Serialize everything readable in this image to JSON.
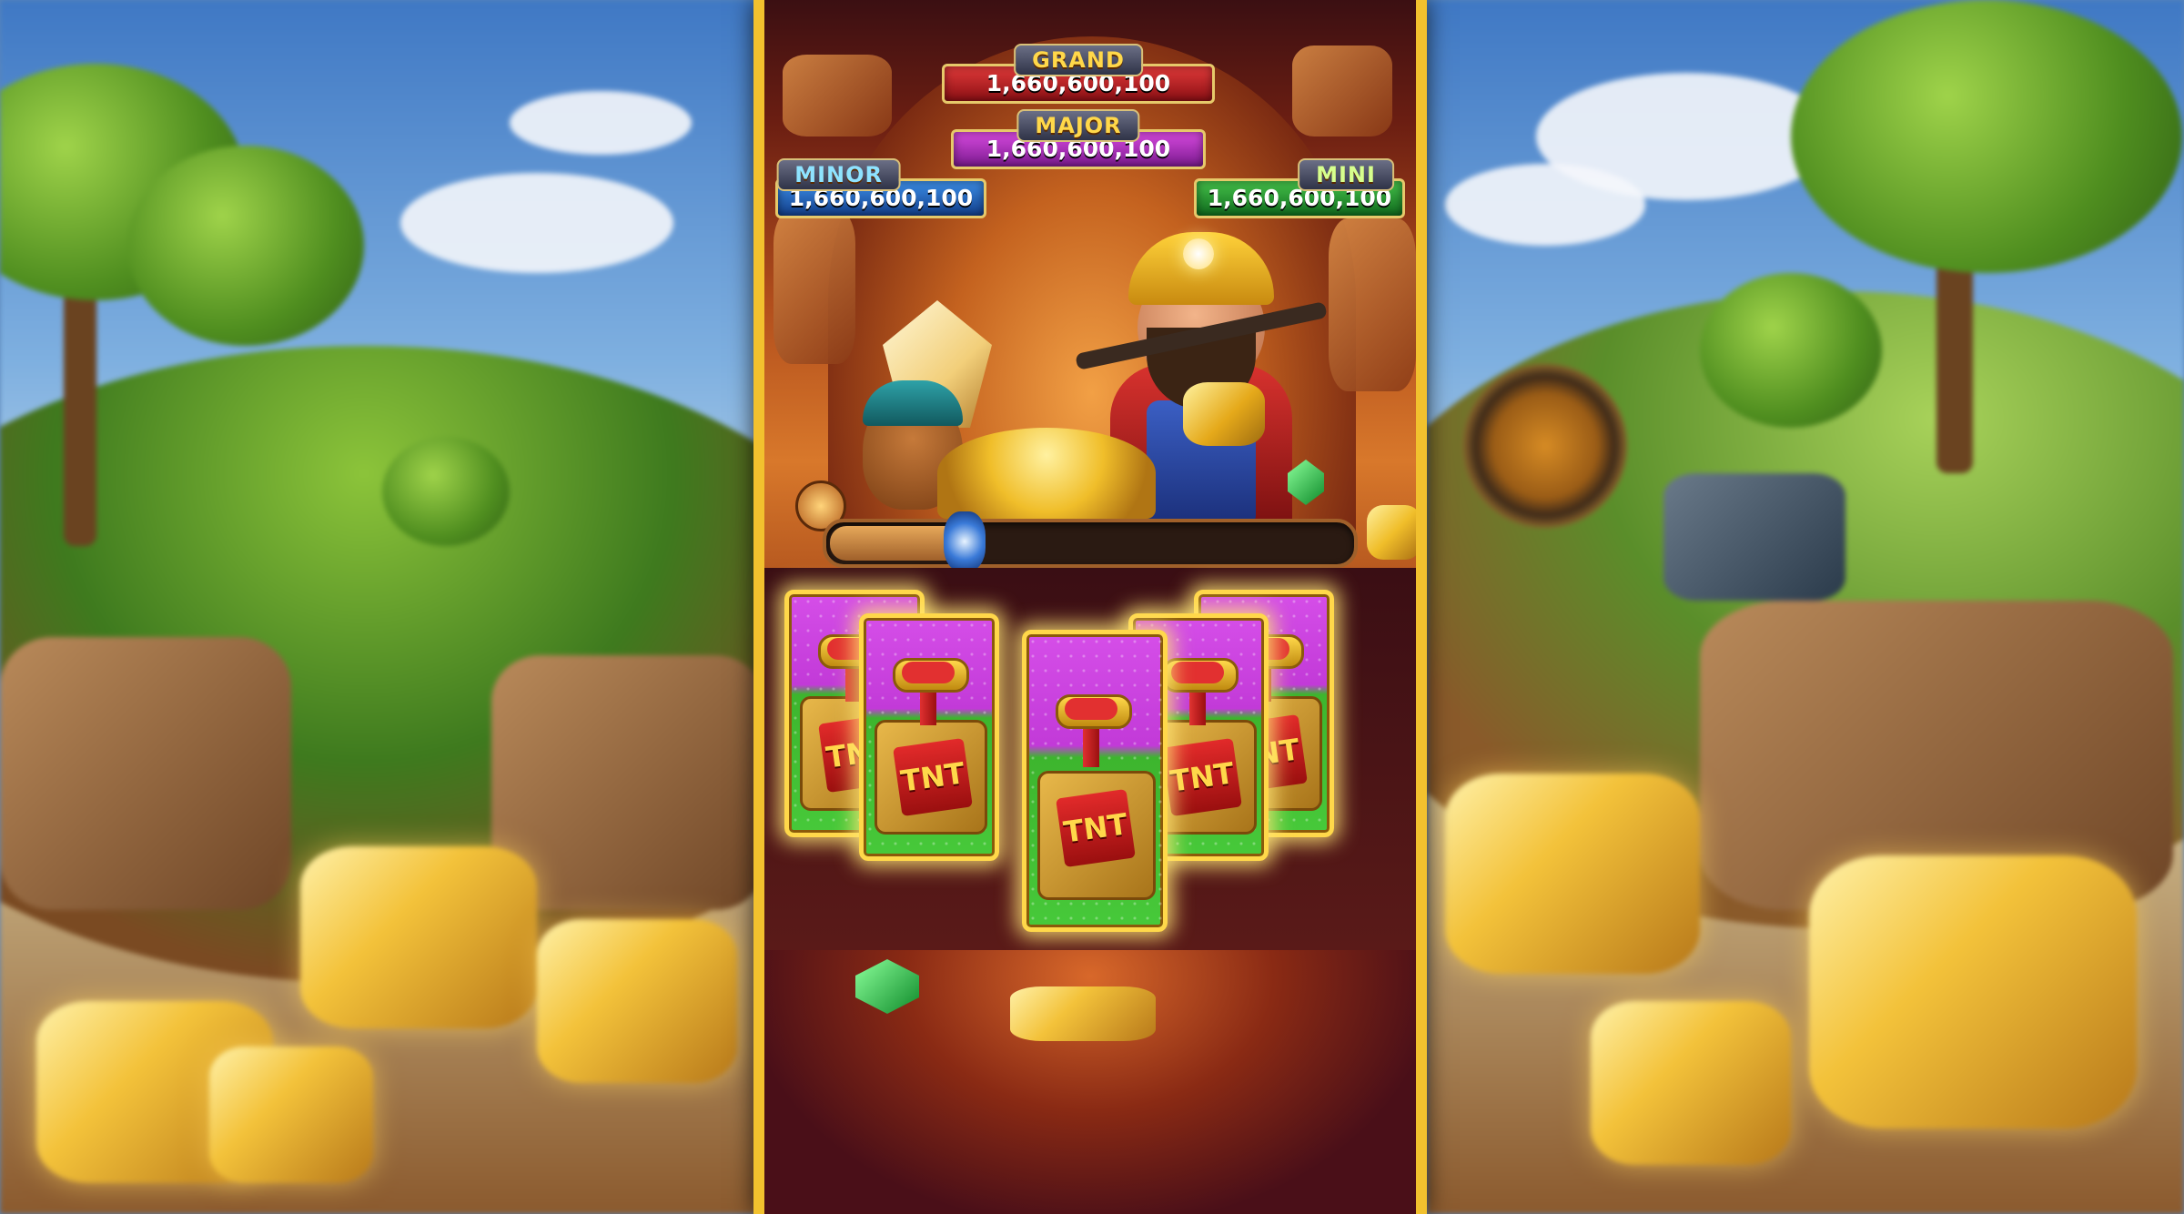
{
  "jackpots": {
    "grand": {
      "label": "GRAND",
      "value": "1,660,600,100"
    },
    "major": {
      "label": "MAJOR",
      "value": "1,660,600,100"
    },
    "minor": {
      "label": "MINOR",
      "value": "1,660,600,100"
    },
    "mini": {
      "label": "MINI",
      "value": "1,660,600,100"
    }
  },
  "progress": {
    "fraction": 0.26
  },
  "reels": {
    "cards": [
      {
        "symbol": "TNT"
      },
      {
        "symbol": "TNT"
      },
      {
        "symbol": "TNT"
      },
      {
        "symbol": "TNT"
      },
      {
        "symbol": "TNT"
      }
    ]
  },
  "colors": {
    "frame": "#f2c12e",
    "grand": "#c21f24",
    "major": "#a02ab2",
    "minor": "#1f5cb8",
    "mini": "#1f8f2e"
  }
}
